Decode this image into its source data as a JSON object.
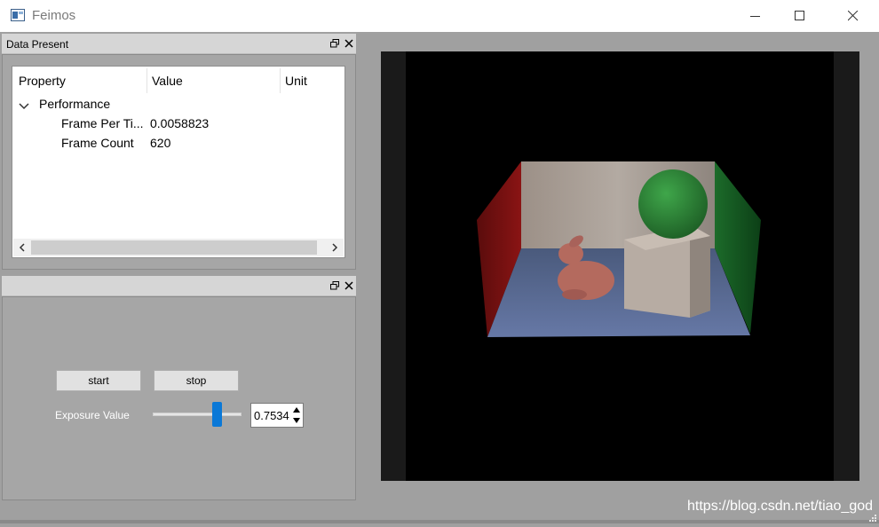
{
  "window": {
    "title": "Feimos",
    "icon": "app-window-icon",
    "controls": [
      "minimize-icon",
      "maximize-icon",
      "close-icon"
    ]
  },
  "data_dock": {
    "title": "Data Present",
    "columns": [
      "Property",
      "Value",
      "Unit"
    ],
    "group_label": "Performance",
    "rows": [
      {
        "property": "Frame Per Ti...",
        "value": "0.0058823",
        "unit": ""
      },
      {
        "property": "Frame Count",
        "value": "620",
        "unit": ""
      }
    ]
  },
  "control_dock": {
    "title": "",
    "start_label": "start",
    "stop_label": "stop",
    "exposure_label": "Exposure Value",
    "exposure_value": "0.7534",
    "slider_fraction": 0.75
  },
  "watermark": "https://blog.csdn.net/tiao_god",
  "colors": {
    "slider_accent": "#0a78d7",
    "left_wall": "#8a1414",
    "right_wall": "#1c6b2a",
    "sphere": "#2f8a3a",
    "floor": "#5a6e9a"
  }
}
